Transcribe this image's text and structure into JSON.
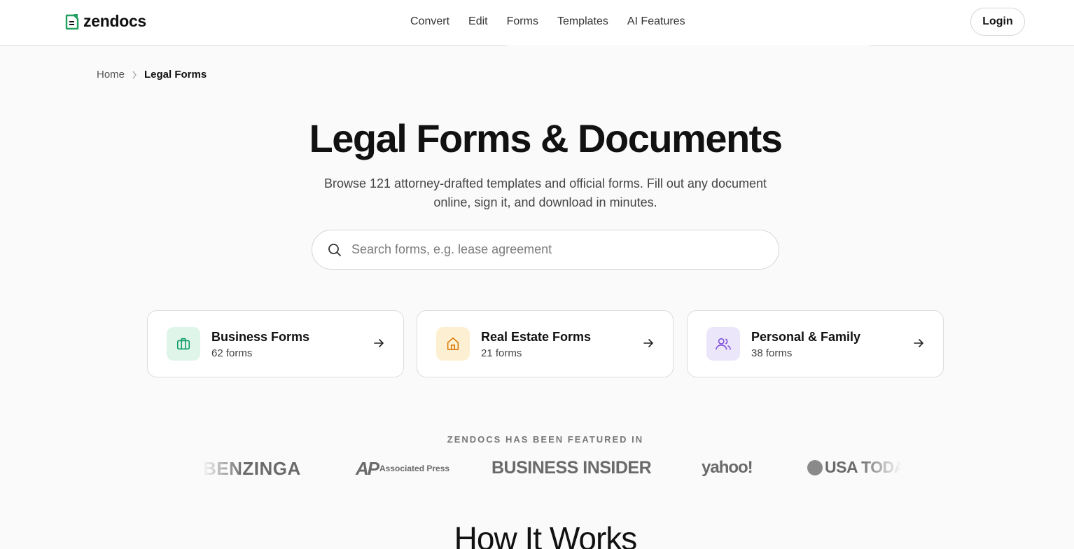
{
  "header": {
    "logo_text": "zendocs",
    "nav": [
      "Convert",
      "Edit",
      "Forms",
      "Templates",
      "AI Features"
    ],
    "login_label": "Login"
  },
  "breadcrumb": {
    "home": "Home",
    "current": "Legal Forms"
  },
  "hero": {
    "title": "Legal Forms & Documents",
    "subtitle": "Browse 121 attorney-drafted templates and official forms. Fill out any document online, sign it, and download in minutes.",
    "search_placeholder": "Search forms, e.g. lease agreement"
  },
  "categories": [
    {
      "title": "Business Forms",
      "count": "62 forms",
      "icon": "briefcase-icon",
      "color": "#0f9b6b",
      "bg": "#dff5ea"
    },
    {
      "title": "Real Estate Forms",
      "count": "21 forms",
      "icon": "house-icon",
      "color": "#d97706",
      "bg": "#fdf0d2"
    },
    {
      "title": "Personal & Family",
      "count": "38 forms",
      "icon": "users-icon",
      "color": "#7c4ddb",
      "bg": "#ece6fb"
    }
  ],
  "featured": {
    "label": "ZENDOCS HAS BEEN FEATURED IN",
    "brands": [
      "BENZINGA",
      "AP",
      "Associated Press",
      "BUSINESS INSIDER",
      "yahoo!",
      "USA TODAY"
    ]
  },
  "how_it_works": {
    "title": "How It Works"
  },
  "colors": {
    "brand_green": "#22a060",
    "text": "#111111",
    "background": "#fafafa"
  }
}
